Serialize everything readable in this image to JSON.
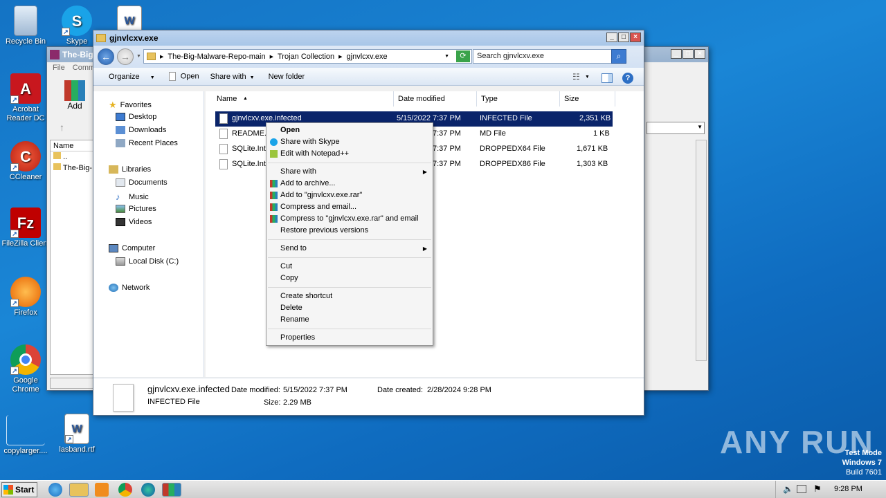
{
  "desktop": {
    "icons": [
      {
        "label": "Recycle Bin"
      },
      {
        "label": "Skype"
      },
      {
        "label": "Acrobat Reader DC"
      },
      {
        "label": "CCleaner"
      },
      {
        "label": "FileZilla Client"
      },
      {
        "label": "Firefox"
      },
      {
        "label": "Google Chrome"
      },
      {
        "label": "copylarger...."
      },
      {
        "label": "lasband.rtf"
      }
    ]
  },
  "bg_window": {
    "title": "The-Big-",
    "menu_file": "File",
    "menu_comm": "Comm",
    "add_label": "Add",
    "col_name": "Name",
    "rows": [
      "..",
      "The-Big-"
    ]
  },
  "explorer": {
    "title": "gjnvlcxv.exe",
    "breadcrumb": [
      "The-Big-Malware-Repo-main",
      "Trojan Collection",
      "gjnvlcxv.exe"
    ],
    "search_placeholder": "Search gjnvlcxv.exe",
    "toolbar": {
      "organize": "Organize",
      "open": "Open",
      "share_with": "Share with",
      "new_folder": "New folder"
    },
    "nav": {
      "favorites": "Favorites",
      "favorites_items": [
        "Desktop",
        "Downloads",
        "Recent Places"
      ],
      "libraries": "Libraries",
      "libraries_items": [
        "Documents",
        "Music",
        "Pictures",
        "Videos"
      ],
      "computer": "Computer",
      "computer_items": [
        "Local Disk (C:)"
      ],
      "network": "Network"
    },
    "columns": {
      "name": "Name",
      "date": "Date modified",
      "type": "Type",
      "size": "Size"
    },
    "files": [
      {
        "name": "gjnvlcxv.exe.infected",
        "date": "5/15/2022 7:37 PM",
        "type": "INFECTED File",
        "size": "2,351 KB"
      },
      {
        "name": "README.m",
        "date": "7:37 PM",
        "type": "MD File",
        "size": "1 KB"
      },
      {
        "name": "SQLite.Int",
        "date": "7:37 PM",
        "type": "DROPPEDX64 File",
        "size": "1,671 KB"
      },
      {
        "name": "SQLite.Int",
        "date": "7:37 PM",
        "type": "DROPPEDX86 File",
        "size": "1,303 KB"
      }
    ],
    "details": {
      "filename": "gjnvlcxv.exe.infected",
      "filetype": "INFECTED File",
      "date_modified_label": "Date modified:",
      "date_modified": "5/15/2022 7:37 PM",
      "size_label": "Size:",
      "size": "2.29 MB",
      "date_created_label": "Date created:",
      "date_created": "2/28/2024 9:28 PM"
    }
  },
  "context_menu": {
    "open": "Open",
    "share_skype": "Share with Skype",
    "edit_notepad": "Edit with Notepad++",
    "share_with": "Share with",
    "add_archive": "Add to archive...",
    "add_rar": "Add to \"gjnvlcxv.exe.rar\"",
    "compress_email": "Compress and email...",
    "compress_rar_email": "Compress to \"gjnvlcxv.exe.rar\" and email",
    "restore": "Restore previous versions",
    "send_to": "Send to",
    "cut": "Cut",
    "copy": "Copy",
    "create_shortcut": "Create shortcut",
    "delete": "Delete",
    "rename": "Rename",
    "properties": "Properties"
  },
  "taskbar": {
    "start": "Start",
    "clock": "9:28 PM"
  },
  "watermark": {
    "brand": "ANY RUN",
    "mode": "Test Mode",
    "os": "Windows 7",
    "build": "Build 7601"
  },
  "colors": {
    "desktop": "#1a86d6",
    "selection": "#0a246a",
    "accent": "#3d7bd1"
  }
}
